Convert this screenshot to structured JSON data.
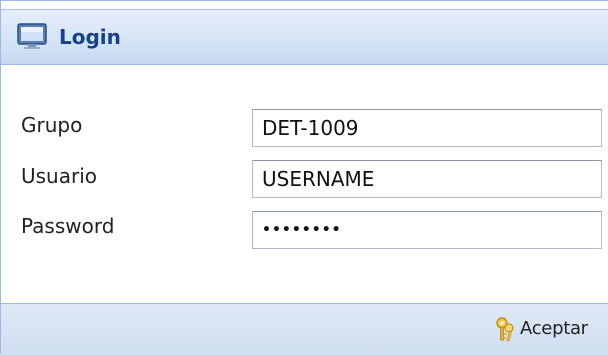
{
  "window": {
    "title": "Login",
    "icon": "monitor-icon"
  },
  "form": {
    "fields": [
      {
        "label": "Grupo",
        "value": "DET-1009",
        "type": "text"
      },
      {
        "label": "Usuario",
        "value": "USERNAME",
        "type": "text"
      },
      {
        "label": "Password",
        "value": "••••••••",
        "type": "password"
      }
    ]
  },
  "footer": {
    "accept_label": "Aceptar",
    "accept_icon": "keys-icon"
  },
  "colors": {
    "title_text": "#15428b",
    "border": "#99bbe8",
    "header_bg": "#d9e6f7"
  }
}
